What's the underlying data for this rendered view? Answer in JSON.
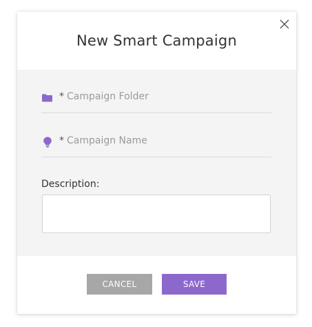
{
  "dialog": {
    "title": "New Smart Campaign",
    "close_icon": "close-icon"
  },
  "form": {
    "campaign_folder": {
      "required_marker": "*",
      "placeholder": "Campaign Folder",
      "icon": "folder-icon"
    },
    "campaign_name": {
      "required_marker": "*",
      "placeholder": "Campaign Name",
      "icon": "lightbulb-icon"
    },
    "description": {
      "label": "Description:",
      "value": ""
    }
  },
  "actions": {
    "cancel_label": "CANCEL",
    "save_label": "SAVE"
  },
  "colors": {
    "accent": "#8d68cc",
    "cancel": "#a7a7a7",
    "body_bg": "#f4f4f4"
  }
}
